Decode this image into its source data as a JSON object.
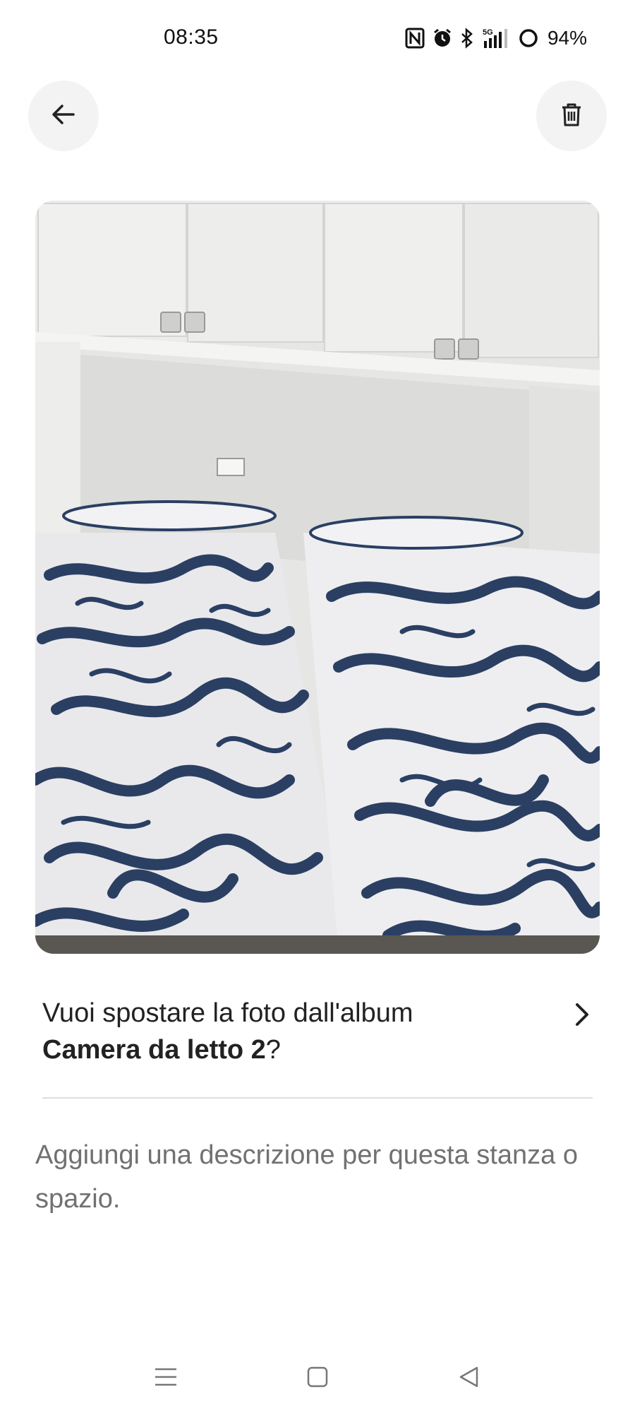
{
  "status_bar": {
    "time": "08:35",
    "network": "5G",
    "battery": "94%",
    "icons": [
      "nfc-icon",
      "alarm-icon",
      "bluetooth-icon",
      "signal-5g-icon",
      "battery-icon"
    ]
  },
  "header": {
    "back_icon": "arrow-left-icon",
    "delete_icon": "trash-icon"
  },
  "photo": {
    "subject": "twin-beds-photo"
  },
  "album_move": {
    "prefix": "Vuoi spostare la foto dall'album",
    "album_name": "Camera da letto 2",
    "suffix": "?",
    "chevron_icon": "chevron-right-icon"
  },
  "description": {
    "placeholder": "Aggiungi una descrizione per questa stanza o spazio."
  },
  "system_nav": {
    "icons": [
      "menu-icon",
      "home-icon",
      "back-triangle-icon"
    ]
  },
  "colors": {
    "button_bg": "#f3f3f3",
    "text_primary": "#222222",
    "text_secondary": "#717171",
    "divider": "#dddddd",
    "bedding_pattern": "#2b3f63"
  }
}
